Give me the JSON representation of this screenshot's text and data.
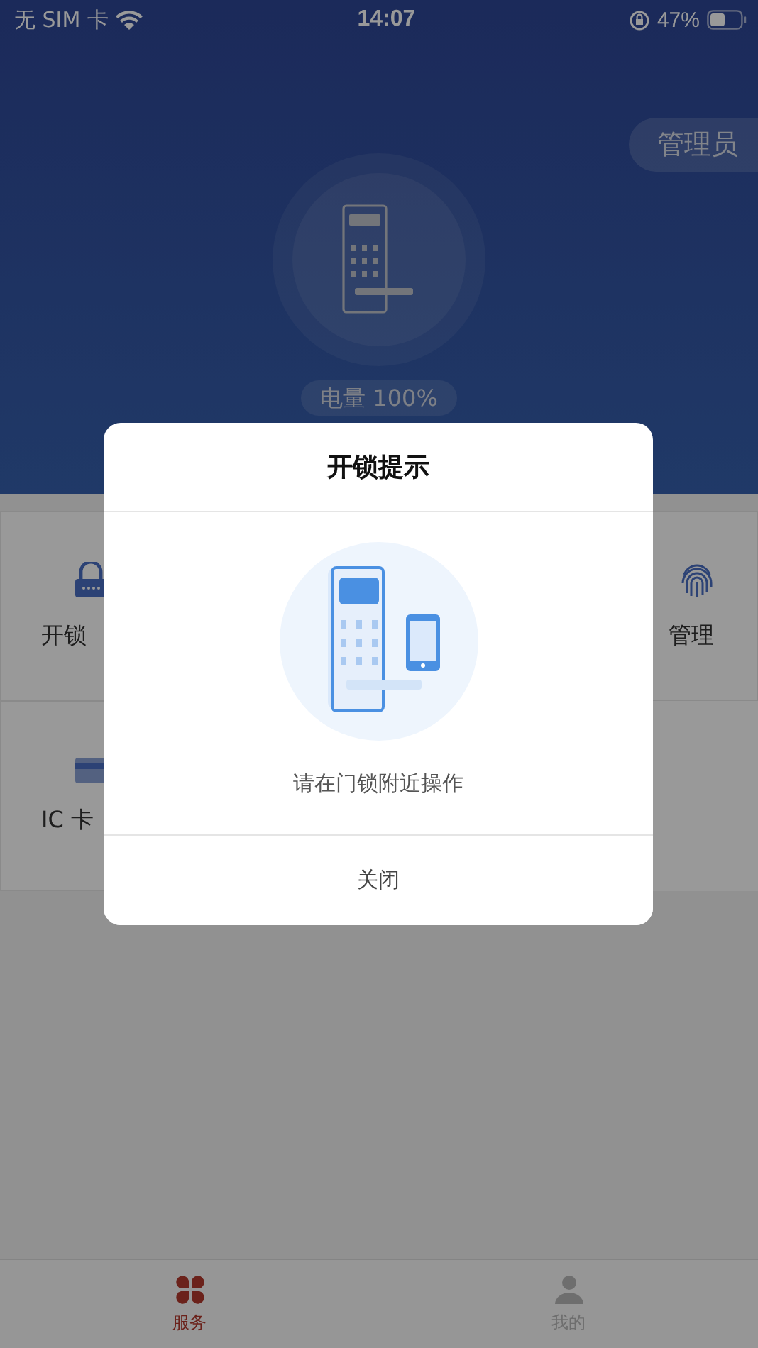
{
  "status_bar": {
    "carrier": "无 SIM 卡",
    "time": "14:07",
    "battery": "47%"
  },
  "header": {
    "role_badge": "管理员",
    "battery_label": "电量 100%"
  },
  "grid": [
    {
      "label": "开锁",
      "kind": "lock"
    },
    {
      "label": "管理",
      "kind": "fingerprint"
    },
    {
      "label": "IC 卡",
      "kind": "card"
    }
  ],
  "dialog": {
    "title": "开锁提示",
    "message": "请在门锁附近操作",
    "button": "关闭"
  },
  "tab_bar": [
    {
      "label": "服务",
      "kind": "services",
      "selected": true
    },
    {
      "label": "我的",
      "kind": "profile",
      "selected": false
    }
  ]
}
